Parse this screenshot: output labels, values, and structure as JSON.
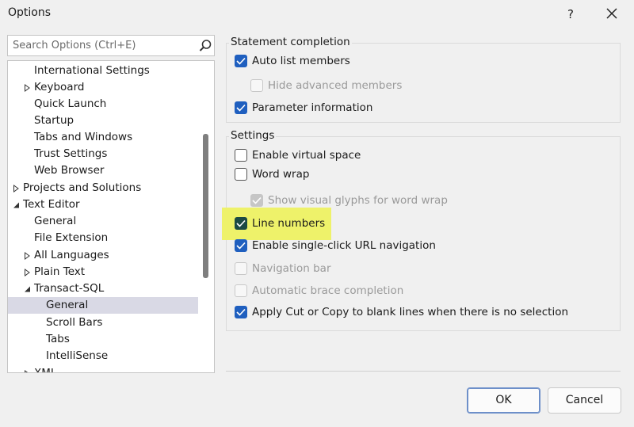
{
  "window": {
    "title": "Options",
    "help_label": "?"
  },
  "search": {
    "placeholder": "Search Options (Ctrl+E)"
  },
  "tree": {
    "items": [
      {
        "label": "International Settings"
      },
      {
        "label": "Keyboard"
      },
      {
        "label": "Quick Launch"
      },
      {
        "label": "Startup"
      },
      {
        "label": "Tabs and Windows"
      },
      {
        "label": "Trust Settings"
      },
      {
        "label": "Web Browser"
      },
      {
        "label": "Projects and Solutions"
      },
      {
        "label": "Text Editor"
      },
      {
        "label": "General"
      },
      {
        "label": "File Extension"
      },
      {
        "label": "All Languages"
      },
      {
        "label": "Plain Text"
      },
      {
        "label": "Transact-SQL"
      },
      {
        "label": "General"
      },
      {
        "label": "Scroll Bars"
      },
      {
        "label": "Tabs"
      },
      {
        "label": "IntelliSense"
      },
      {
        "label": "XML"
      }
    ]
  },
  "statement_completion": {
    "title": "Statement completion",
    "options": [
      {
        "label": "Auto list members",
        "checked": true,
        "enabled": true
      },
      {
        "label": "Hide advanced members",
        "checked": false,
        "enabled": false
      },
      {
        "label": "Parameter information",
        "checked": true,
        "enabled": true
      }
    ]
  },
  "settings": {
    "title": "Settings",
    "options": [
      {
        "label": "Enable virtual space",
        "checked": false,
        "enabled": true
      },
      {
        "label": "Word wrap",
        "checked": false,
        "enabled": true
      },
      {
        "label": "Show visual glyphs for word wrap",
        "checked": true,
        "enabled": false
      },
      {
        "label": "Line numbers",
        "checked": true,
        "enabled": true,
        "highlighted": true
      },
      {
        "label": "Enable single-click URL navigation",
        "checked": true,
        "enabled": true
      },
      {
        "label": "Navigation bar",
        "checked": false,
        "enabled": false
      },
      {
        "label": "Automatic brace completion",
        "checked": false,
        "enabled": false
      },
      {
        "label": "Apply Cut or Copy to blank lines when there is no selection",
        "checked": true,
        "enabled": true
      }
    ]
  },
  "buttons": {
    "ok": "OK",
    "cancel": "Cancel"
  },
  "colors": {
    "checkbox_accent": "#1f5fbf",
    "highlight": "#eef26a",
    "selected_row": "#d9d9e5"
  },
  "icons": {
    "close": "close-icon",
    "search": "search-icon",
    "expand": "chevron-right-icon",
    "collapse": "chevron-down-icon",
    "check": "check-icon"
  }
}
